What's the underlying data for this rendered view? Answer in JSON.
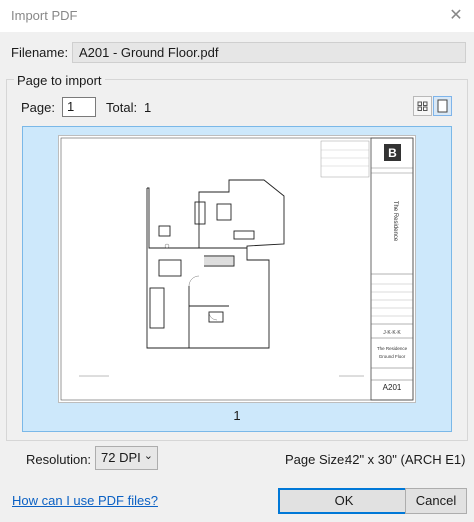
{
  "window": {
    "title": "Import PDF",
    "close": "✕"
  },
  "filename": {
    "label": "Filename:",
    "value": "A201 - Ground Floor.pdf"
  },
  "page_to_import": {
    "title": "Page to import",
    "page_label": "Page:",
    "page_value": "1",
    "total_label": "Total:",
    "total_value": "1",
    "preview_page_number": "1"
  },
  "drawing": {
    "sheet_number": "A201",
    "project_vertical": "The Residence",
    "firm": "J·K·K·K",
    "project_name": "The Residence",
    "sheet_name": "Ground Floor"
  },
  "resolution": {
    "label": "Resolution:",
    "value": "72 DPI"
  },
  "page_size": {
    "label": "Page Size:",
    "value": "42\" x 30\" (ARCH E1)"
  },
  "help_link": "How can I use PDF files?",
  "buttons": {
    "ok": "OK",
    "cancel": "Cancel"
  }
}
